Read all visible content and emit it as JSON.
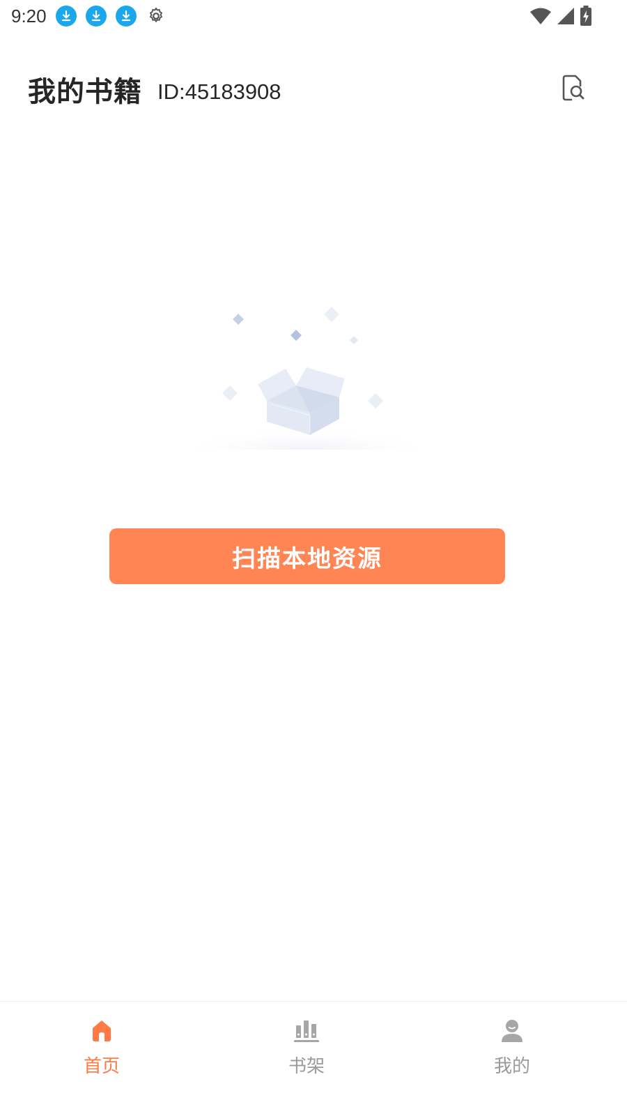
{
  "status_bar": {
    "time": "9:20",
    "left_icons": [
      "download-icon",
      "download-icon",
      "download-icon",
      "gear-icon"
    ],
    "right_icons": [
      "wifi-icon",
      "signal-icon",
      "battery-charging-icon"
    ]
  },
  "header": {
    "title": "我的书籍",
    "user_id": "ID:45183908",
    "search_icon": "document-search-icon"
  },
  "empty_state": {
    "illustration": "empty-box-icon",
    "scan_button_label": "扫描本地资源"
  },
  "bottom_nav": {
    "items": [
      {
        "label": "首页",
        "icon": "home-icon",
        "active": true
      },
      {
        "label": "书架",
        "icon": "bookshelf-icon",
        "active": false
      },
      {
        "label": "我的",
        "icon": "profile-icon",
        "active": false
      }
    ]
  },
  "colors": {
    "accent": "#ff8554",
    "active_nav": "#ff7a45",
    "inactive_nav": "#9a9a9a",
    "status_download": "#1aa7ec"
  }
}
